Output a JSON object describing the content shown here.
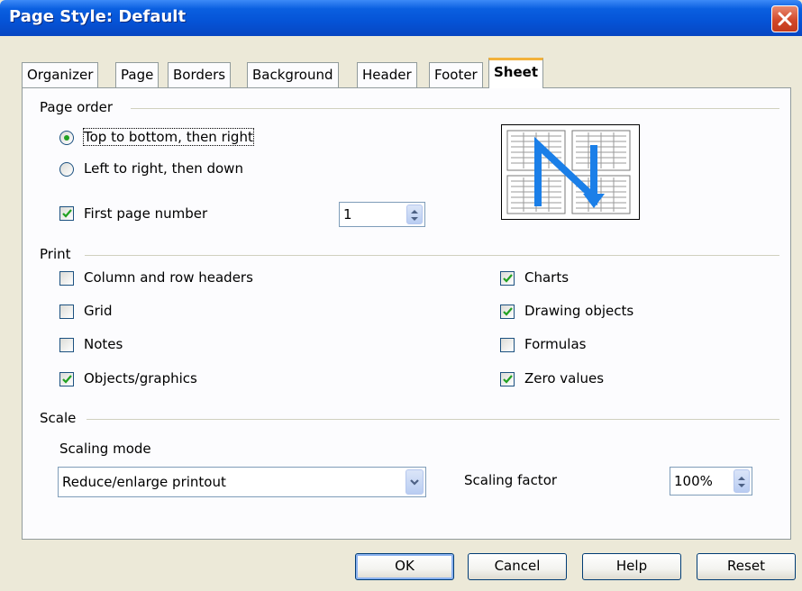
{
  "window": {
    "title": "Page Style: Default"
  },
  "tabs": [
    {
      "label": "Organizer"
    },
    {
      "label": "Page"
    },
    {
      "label": "Borders"
    },
    {
      "label": "Background"
    },
    {
      "label": "Header"
    },
    {
      "label": "Footer"
    },
    {
      "label": "Sheet",
      "active": true
    }
  ],
  "page_order": {
    "heading": "Page order",
    "top_to_bottom": {
      "label": "Top to bottom, then right",
      "selected": true
    },
    "left_to_right": {
      "label": "Left to right, then down",
      "selected": false
    },
    "first_page_number": {
      "label": "First page number",
      "checked": true,
      "value": "1"
    }
  },
  "print": {
    "heading": "Print",
    "column_row_headers": {
      "label": "Column and row headers",
      "checked": false
    },
    "grid": {
      "label": "Grid",
      "checked": false
    },
    "notes": {
      "label": "Notes",
      "checked": false
    },
    "objects_graphics": {
      "label": "Objects/graphics",
      "checked": true
    },
    "charts": {
      "label": "Charts",
      "checked": true
    },
    "drawing_objects": {
      "label": "Drawing objects",
      "checked": true
    },
    "formulas": {
      "label": "Formulas",
      "checked": false
    },
    "zero_values": {
      "label": "Zero values",
      "checked": true
    }
  },
  "scale": {
    "heading": "Scale",
    "mode_label": "Scaling mode",
    "mode_value": "Reduce/enlarge printout",
    "factor_label": "Scaling factor",
    "factor_value": "100%"
  },
  "buttons": {
    "ok": "OK",
    "cancel": "Cancel",
    "help": "Help",
    "reset": "Reset"
  },
  "colors": {
    "titlebar": "#0553d6",
    "active_tab_accent": "#f3b23b",
    "checkmark": "#21a121",
    "preview_arrow": "#1b7fe8"
  }
}
